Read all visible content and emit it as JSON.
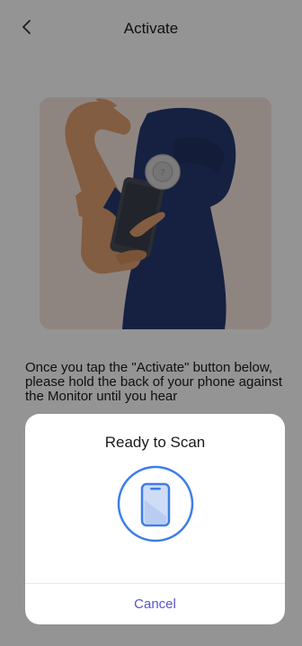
{
  "header": {
    "title": "Activate",
    "back_icon": "chevron-left-icon"
  },
  "illustration": {
    "description_icon": "arm-sensor-illustration",
    "colors": {
      "panel": "#f7e6dc",
      "skin": "#e0a073",
      "shirt": "#273a73",
      "phone": "#474c57",
      "sensor": "#d6d6d6"
    }
  },
  "instructions": {
    "text": "Once you tap the \"Activate\" button below, please hold the back of your phone against the Monitor until you hear"
  },
  "scan_sheet": {
    "title": "Ready to Scan",
    "icon": "phone-scan-icon",
    "cancel_label": "Cancel",
    "accent_color": "#3d7ee8",
    "cancel_color": "#5a54c8"
  }
}
